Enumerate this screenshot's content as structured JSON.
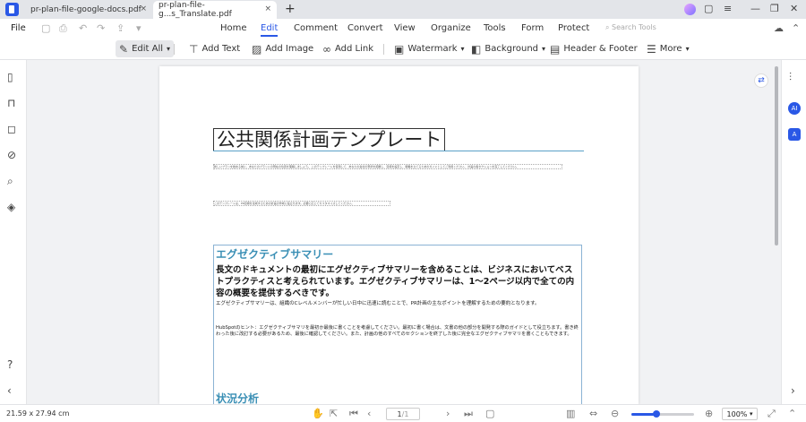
{
  "tabs": [
    {
      "title": "pr-plan-file-google-docs.pdf",
      "close": "×"
    },
    {
      "title": "pr-plan-file-g...s_Translate.pdf",
      "close": "×"
    }
  ],
  "window": {
    "add_tab": "+",
    "min": "—",
    "restore": "❐",
    "close": "✕",
    "msg": "▢",
    "menu": "≡"
  },
  "menu": {
    "file": "File",
    "items": [
      "Home",
      "Edit",
      "Comment",
      "Convert",
      "View",
      "Organize",
      "Tools",
      "Form",
      "Protect"
    ],
    "active": "Edit",
    "search_placeholder": "Search Tools"
  },
  "toolbar": {
    "edit_all": "Edit All",
    "add_text": "Add Text",
    "add_image": "Add Image",
    "add_link": "Add Link",
    "watermark": "Watermark",
    "background": "Background",
    "header_footer": "Header & Footer",
    "more": "More"
  },
  "document": {
    "title": "公共関係計画テンプレート",
    "tiny_line_1": "新しいプランを始める前に、あなたのブランドの現在の位置を理解しましょう。 このテンプレートを使用して、あなたの会社の現状を把握し、目標を設定し、戦略を立てるためのガイドとしてご利用ください。 計画の各セクションを完了してください。",
    "tiny_line_2": "このテンプレートは、PR目標を達成するための計画の作成に役立ちます。必要に応じてカスタマイズしてください。",
    "exec_heading": "エグゼクティブサマリー",
    "exec_lead": "長文のドキュメントの最初にエグゼクティブサマリーを含めることは、ビジネスにおいてベストプラクティスと考えられています。エグゼクティブサマリーは、1～2ページ以内で全ての内容の概要を提供するべきです。",
    "exec_small": "エグゼクティブサマリーは、組織のCレベルメンバーが忙しい日中に迅速に読むことで、PR計画の主なポイントを理解するための要約となります。",
    "exec_hint": "HubSpotのヒント：エグゼクティブサマリを最初か最後に書くことを考慮してください。最初に書く場合は、文書の他の部分を開発する際のガイドとして役立ちます。書き終わった後に改訂する必要があるため、最後に確認してください。また、計画の他のすべてのセクションを終了した後に完全なエグゼクティブサマリを書くこともできます。",
    "status_heading": "状況分析"
  },
  "status": {
    "page_size": "21.59 x 27.94 cm",
    "page_current": "1",
    "page_total": "/1",
    "zoom": "100%",
    "zoom_level": 0.4
  }
}
